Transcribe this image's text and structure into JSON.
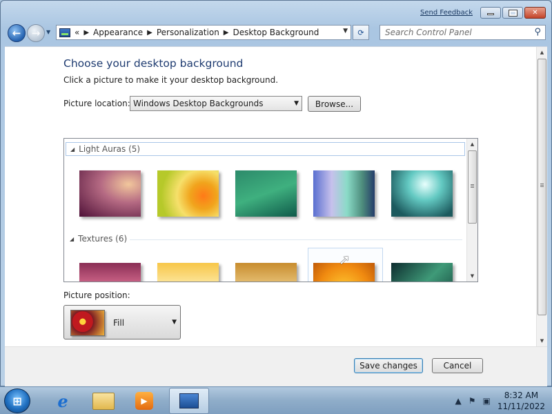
{
  "titlebar": {
    "send_feedback": "Send Feedback",
    "minimize": "",
    "maximize": "",
    "close": "✕"
  },
  "nav": {
    "back": "←",
    "forward": "→",
    "breadcrumb_prefix": "«",
    "breadcrumb": [
      "Appearance",
      "Personalization",
      "Desktop Background"
    ],
    "search_placeholder": "Search Control Panel",
    "refresh": "⟳"
  },
  "page": {
    "title": "Choose your desktop background",
    "subtitle": "Click a picture to make it your desktop background.",
    "location_label": "Picture location:",
    "location_value": "Windows Desktop Backgrounds",
    "browse_label": "Browse...",
    "position_label": "Picture position:",
    "position_value": "Fill"
  },
  "gallery": {
    "groups": [
      {
        "name": "Light Auras (5)",
        "thumbs": [
          "aura-1",
          "aura-2",
          "aura-3",
          "aura-4",
          "aura-5"
        ]
      },
      {
        "name": "Textures (6)",
        "thumbs": [
          "texture-1",
          "texture-2",
          "texture-3",
          "texture-4",
          "texture-5"
        ]
      }
    ]
  },
  "footer": {
    "save_label": "Save changes",
    "cancel_label": "Cancel"
  },
  "taskbar": {
    "start": "⊞",
    "items": [
      "internet-explorer",
      "windows-explorer",
      "media-player",
      "control-panel"
    ],
    "time": "8:32 AM",
    "date": "11/11/2022"
  },
  "colors": {
    "title_blue": "#1e3b70",
    "window_frame": "#aac6e2",
    "taskbar": "#8fadc9"
  }
}
